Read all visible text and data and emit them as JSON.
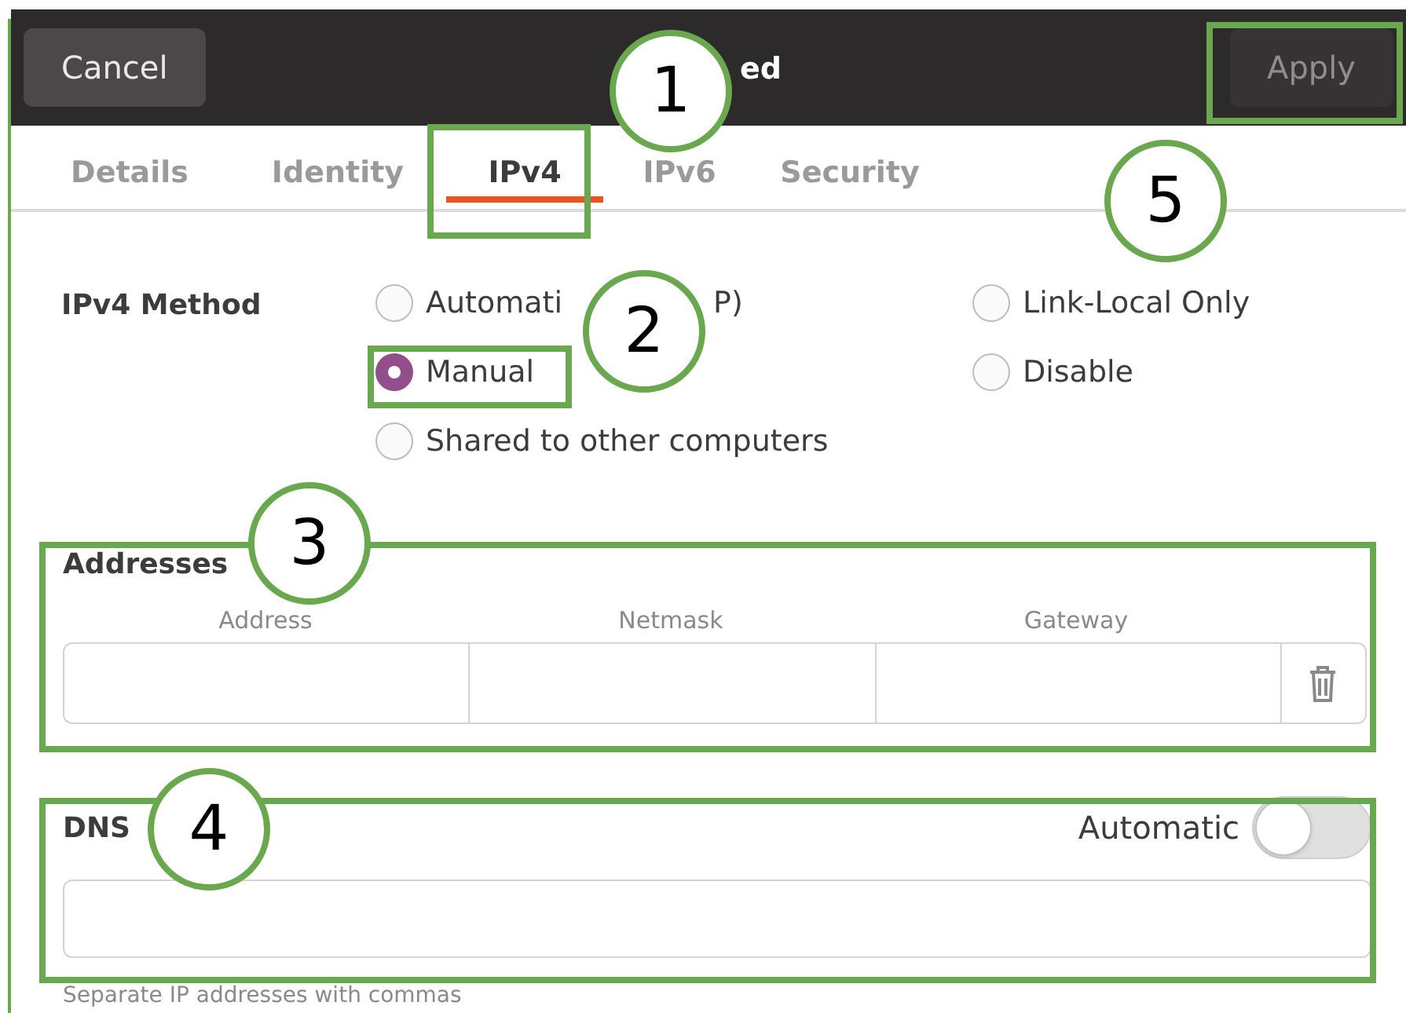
{
  "header": {
    "title_fragment": "ed",
    "cancel": "Cancel",
    "apply": "Apply"
  },
  "tabs": [
    {
      "label": "Details",
      "selected": false
    },
    {
      "label": "Identity",
      "selected": false
    },
    {
      "label": "IPv4",
      "selected": true
    },
    {
      "label": "IPv6",
      "selected": false
    },
    {
      "label": "Security",
      "selected": false
    }
  ],
  "ipv4_method": {
    "label": "IPv4 Method",
    "options": [
      {
        "label": "Automati",
        "label_tail": "P)",
        "selected": false
      },
      {
        "label": "Manual",
        "selected": true
      },
      {
        "label": "Shared to other computers",
        "selected": false
      },
      {
        "label": "Link-Local Only",
        "selected": false
      },
      {
        "label": "Disable",
        "selected": false
      }
    ]
  },
  "addresses": {
    "heading": "Addresses",
    "columns": [
      "Address",
      "Netmask",
      "Gateway"
    ]
  },
  "dns": {
    "heading": "DNS",
    "automatic_label": "Automatic",
    "automatic_on": false,
    "hint": "Separate IP addresses with commas"
  },
  "callouts": [
    "1",
    "2",
    "3",
    "4",
    "5"
  ]
}
